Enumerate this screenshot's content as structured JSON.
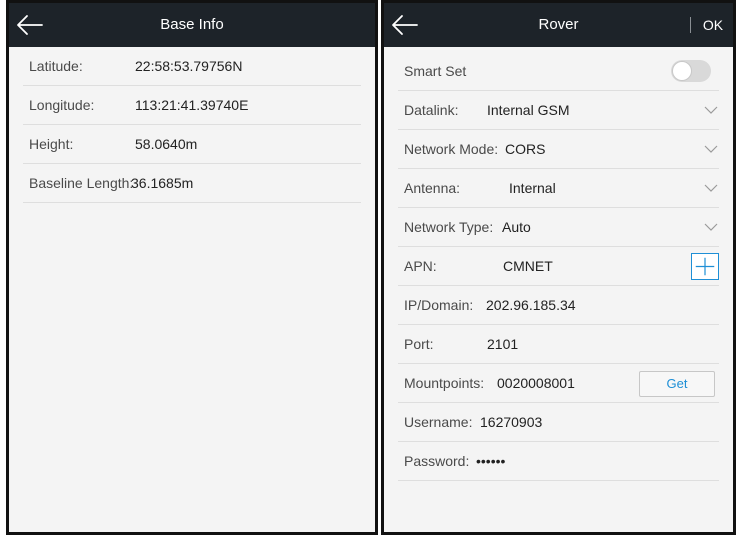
{
  "base_info": {
    "title": "Base Info",
    "rows": [
      {
        "label": "Latitude:",
        "value": "22:58:53.79756N"
      },
      {
        "label": "Longitude:",
        "value": "113:21:41.39740E"
      },
      {
        "label": "Height:",
        "value": "58.0640m"
      },
      {
        "label": "Baseline Length:",
        "value": "36.1685m"
      }
    ]
  },
  "rover": {
    "title": "Rover",
    "ok_label": "OK",
    "smart_set": {
      "label": "Smart Set",
      "enabled": false
    },
    "datalink": {
      "label": "Datalink:",
      "value": "Internal GSM"
    },
    "network_mode": {
      "label": "Network Mode:",
      "value": "CORS"
    },
    "antenna": {
      "label": "Antenna:",
      "value": "Internal"
    },
    "network_type": {
      "label": "Network Type:",
      "value": "Auto"
    },
    "apn": {
      "label": "APN:",
      "value": "CMNET"
    },
    "ip_domain": {
      "label": "IP/Domain:",
      "value": "202.96.185.34"
    },
    "port": {
      "label": "Port:",
      "value": "2101"
    },
    "mountpoints": {
      "label": "Mountpoints:",
      "value": "0020008001",
      "button_label": "Get"
    },
    "username": {
      "label": "Username:",
      "value": "16270903"
    },
    "password": {
      "label": "Password:",
      "value": "••••••"
    }
  },
  "colors": {
    "titlebar": "#1d2329",
    "background": "#f4f4f4",
    "accent": "#1e8fd6",
    "divider": "#dedede"
  },
  "icons": [
    "back-arrow-icon",
    "chevron-down-icon",
    "plus-icon"
  ]
}
